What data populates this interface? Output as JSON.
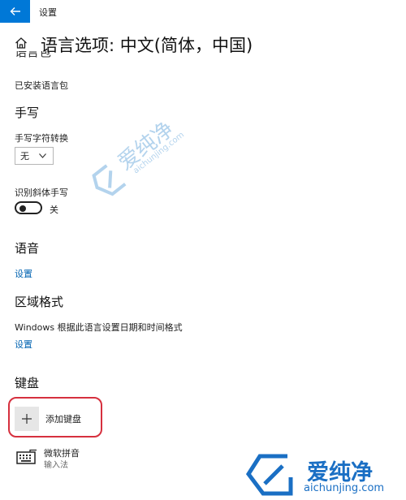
{
  "window": {
    "title": "设置"
  },
  "page": {
    "title": "语言选项: 中文(简体，中国)"
  },
  "sections": {
    "language_pack": {
      "heading_cut": "语言包",
      "status": "已安装语言包"
    },
    "handwriting": {
      "heading": "手写",
      "conversion_label": "手写字符转换",
      "conversion_value": "无",
      "italic_label": "识别斜体手写",
      "italic_state": "关"
    },
    "speech": {
      "heading": "语音",
      "settings_link": "设置"
    },
    "regional_format": {
      "heading": "区域格式",
      "description": "Windows 根据此语言设置日期和时间格式",
      "settings_link": "设置"
    },
    "keyboards": {
      "heading": "键盘",
      "add_label": "添加键盘",
      "items": [
        {
          "name": "微软拼音",
          "type": "输入法"
        }
      ]
    }
  },
  "watermark": {
    "cn": "爱纯净",
    "en": "aichunjing.com"
  },
  "colors": {
    "accent": "#0078d7",
    "link": "#0063b1",
    "highlight": "#d6303e",
    "watermark": "#1a6fc4"
  }
}
